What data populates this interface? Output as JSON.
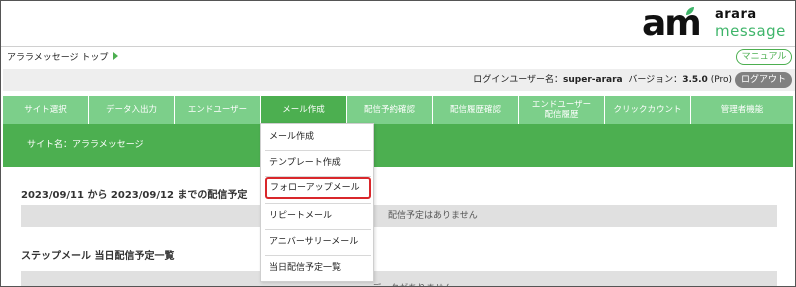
{
  "logo": {
    "mark": "am",
    "line1": "arara",
    "line2": "message"
  },
  "breadcrumb": {
    "label": "アララメッセージ トップ"
  },
  "header": {
    "manual_label": "マニュアル",
    "login_user_prefix": "ログインユーザー名：",
    "login_user": "super-arara",
    "version_prefix": "バージョン：",
    "version": "3.5.0",
    "edition": "(Pro)",
    "logout_label": "ログアウト"
  },
  "nav": {
    "items": [
      {
        "label": "サイト選択"
      },
      {
        "label": "データ入出力"
      },
      {
        "label": "エンドユーザー"
      },
      {
        "label": "メール作成"
      },
      {
        "label": "配信予約確認"
      },
      {
        "label": "配信履歴確認"
      },
      {
        "label": "エンドユーザー\n配信履歴"
      },
      {
        "label": "クリックカウント"
      },
      {
        "label": "管理者機能"
      }
    ],
    "active_index": 3
  },
  "site": {
    "name_label": "サイト名：アララメッセージ"
  },
  "main": {
    "schedule_title": "2023/09/11 から 2023/09/12 までの配信予定",
    "schedule_empty": "配信予定はありません",
    "step_title": "ステップメール 当日配信予定一覧",
    "step_empty": "データがありません"
  },
  "dropdown": {
    "items": [
      {
        "label": "メール作成"
      },
      {
        "label": "テンプレート作成"
      },
      {
        "label": "フォローアップメール"
      },
      {
        "label": "リピートメール"
      },
      {
        "label": "アニバーサリーメール"
      },
      {
        "label": "当日配信予定一覧"
      }
    ],
    "highlighted_index": 2
  },
  "colors": {
    "nav": "#7ccf8a",
    "nav_active": "#4caf50",
    "band": "#4caf50",
    "highlight": "#d9272b",
    "logout": "#808080"
  }
}
